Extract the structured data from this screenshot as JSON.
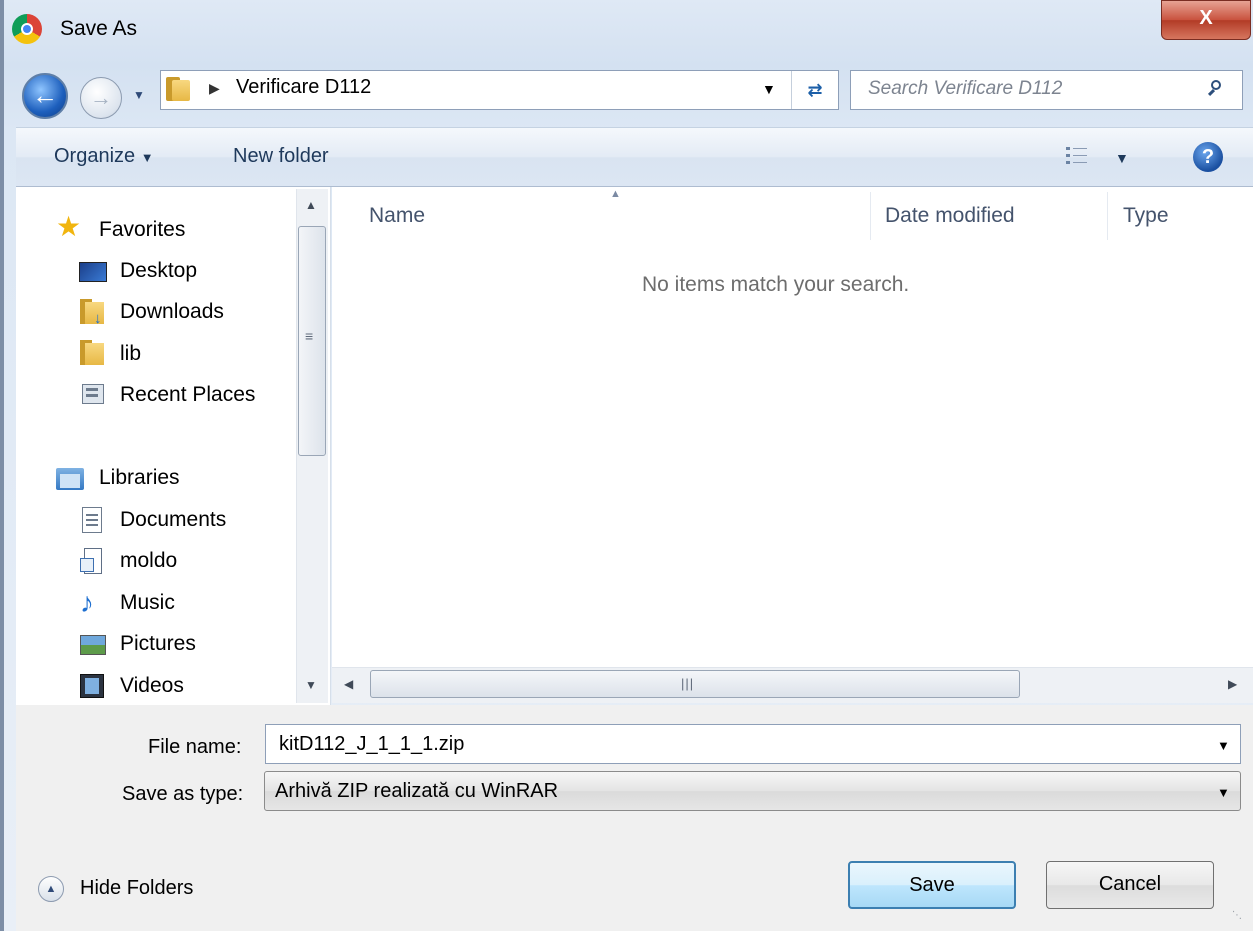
{
  "window": {
    "title": "Save As",
    "close_label": "X"
  },
  "address": {
    "breadcrumb": "Verificare D112",
    "search_placeholder": "Search Verificare D112"
  },
  "toolbar": {
    "organize_label": "Organize",
    "new_folder_label": "New folder"
  },
  "nav": {
    "favorites": {
      "label": "Favorites",
      "items": [
        {
          "label": "Desktop",
          "icon": "desktop-icon"
        },
        {
          "label": "Downloads",
          "icon": "downloads-folder-icon"
        },
        {
          "label": "lib",
          "icon": "folder-icon"
        },
        {
          "label": "Recent Places",
          "icon": "recent-places-icon"
        }
      ]
    },
    "libraries": {
      "label": "Libraries",
      "items": [
        {
          "label": "Documents",
          "icon": "documents-icon"
        },
        {
          "label": "moldo",
          "icon": "library-icon"
        },
        {
          "label": "Music",
          "icon": "music-icon"
        },
        {
          "label": "Pictures",
          "icon": "pictures-icon"
        },
        {
          "label": "Videos",
          "icon": "videos-icon"
        }
      ]
    }
  },
  "file_list": {
    "columns": [
      "Name",
      "Date modified",
      "Type"
    ],
    "empty_message": "No items match your search."
  },
  "form": {
    "file_name_label": "File name:",
    "file_name_value": "kitD112_J_1_1_1.zip",
    "save_type_label": "Save as type:",
    "save_type_value": "Arhivă ZIP realizată cu WinRAR"
  },
  "footer": {
    "hide_folders_label": "Hide Folders",
    "save_label": "Save",
    "cancel_label": "Cancel"
  }
}
